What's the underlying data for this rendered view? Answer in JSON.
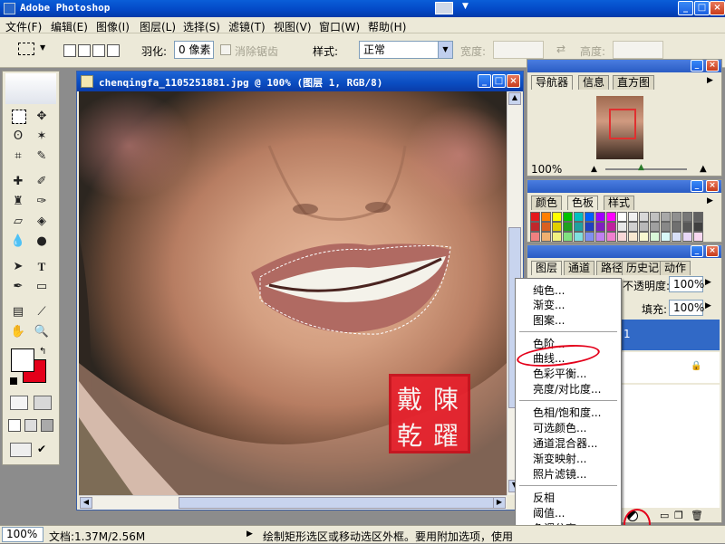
{
  "app": {
    "title": "Adobe Photoshop"
  },
  "menu": [
    {
      "label": "文件(F)"
    },
    {
      "label": "编辑(E)"
    },
    {
      "label": "图像(I)"
    },
    {
      "label": "图层(L)"
    },
    {
      "label": "选择(S)"
    },
    {
      "label": "滤镜(T)"
    },
    {
      "label": "视图(V)"
    },
    {
      "label": "窗口(W)"
    },
    {
      "label": "帮助(H)"
    }
  ],
  "options": {
    "feather_label": "羽化:",
    "feather_value": "0 像素",
    "antialias_label": "消除锯齿",
    "style_label": "样式:",
    "style_value": "正常",
    "width_label": "宽度:",
    "height_label": "高度:"
  },
  "document": {
    "title": "chenqingfa_1105251881.jpg @ 100% (图层 1, RGB/8)",
    "seal_chars": [
      "戴",
      "陳",
      "乾",
      "躍"
    ]
  },
  "navigator": {
    "tabs": [
      "导航器",
      "信息",
      "直方图"
    ],
    "zoom": "100%"
  },
  "swatches_panel": {
    "tabs": [
      "颜色",
      "色板",
      "样式"
    ],
    "colors_row1": [
      "#e41a1c",
      "#ff7f00",
      "#ffff00",
      "#00c000",
      "#00c0c0",
      "#0060ff",
      "#a000ff",
      "#ff00ff",
      "#ffffff",
      "#f0f0f0",
      "#d8d8d8",
      "#c0c0c0",
      "#a8a8a8",
      "#909090",
      "#787878",
      "#606060",
      "#404040",
      "#202020"
    ],
    "colors_row2": [
      "#c0282c",
      "#d86020",
      "#e0d000",
      "#20a020",
      "#20a0a0",
      "#2040c0",
      "#8020c0",
      "#c020a0",
      "#e8e8e8",
      "#d0d0d0",
      "#b8b8b8",
      "#a0a0a0",
      "#888888",
      "#707070",
      "#585858",
      "#404040",
      "#282828",
      "#000000"
    ],
    "colors_row3": [
      "#f08080",
      "#f0b070",
      "#f0f080",
      "#80e080",
      "#80e0e0",
      "#8090f0",
      "#c080f0",
      "#f080d0",
      "#f8d8d8",
      "#f8e8d0",
      "#f8f8d0",
      "#d8f8d8",
      "#d8f8f8",
      "#d8e0f8",
      "#e8d8f8",
      "#f8d8f0",
      "#c8a878",
      "#886040"
    ]
  },
  "layers": {
    "tabs": [
      "图层",
      "通道",
      "路径",
      "历史记录",
      "动作"
    ],
    "opacity_label": "不透明度:",
    "opacity_value": "100%",
    "fill_label": "填充:",
    "fill_value": "100%",
    "layer1_suffix": "1"
  },
  "context_menu": {
    "group1": [
      "纯色...",
      "渐变...",
      "图案..."
    ],
    "group2": [
      "色阶...",
      "曲线...",
      "色彩平衡...",
      "亮度/对比度..."
    ],
    "group3": [
      "色相/饱和度...",
      "可选颜色...",
      "通道混合器...",
      "渐变映射...",
      "照片滤镜..."
    ],
    "group4": [
      "反相",
      "阈值...",
      "色调分离..."
    ]
  },
  "status": {
    "zoom": "100%",
    "doc_info": "文档:1.37M/2.56M",
    "hint": "绘制矩形选区或移动选区外框。要用附加选项，使用"
  },
  "colors": {
    "titlebar": "#0a4cc0",
    "foreground": "#ffffff",
    "background": "#e4001a",
    "annotation": "#e4001a",
    "selected_layer": "#3169c6"
  }
}
